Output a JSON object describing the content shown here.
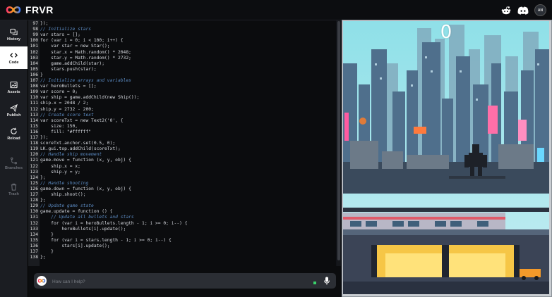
{
  "app": {
    "name": "FRVR",
    "user_initials": "AN"
  },
  "colors": {
    "accent": "#4a6cf7",
    "sky": "#8fdde6",
    "active_tab": "#ffffff"
  },
  "topbar": {
    "icons": [
      "reddit-icon",
      "discord-icon",
      "user-avatar"
    ]
  },
  "sidebar": {
    "items": [
      {
        "label": "History",
        "icon": "history-icon",
        "state": "normal"
      },
      {
        "label": "Code",
        "icon": "code-icon",
        "state": "active"
      },
      {
        "label": "Assets",
        "icon": "image-icon",
        "state": "normal"
      },
      {
        "label": "Publish",
        "icon": "send-icon",
        "state": "normal"
      },
      {
        "label": "Reload",
        "icon": "reload-icon",
        "state": "normal"
      },
      {
        "label": "Branches",
        "icon": "branch-icon",
        "state": "disabled"
      },
      {
        "label": "Trash",
        "icon": "trash-icon",
        "state": "disabled"
      }
    ]
  },
  "code": {
    "lines": [
      {
        "n": "97",
        "text": "});",
        "kind": "code"
      },
      {
        "n": "98",
        "text": "// Initialize stars",
        "kind": "comment"
      },
      {
        "n": "99",
        "text": "var stars = [];",
        "kind": "code"
      },
      {
        "n": "100",
        "text": "for (var i = 0; i < 100; i++) {",
        "kind": "code"
      },
      {
        "n": "101",
        "text": "    var star = new Star();",
        "kind": "code"
      },
      {
        "n": "102",
        "text": "    star.x = Math.random() * 2048;",
        "kind": "code"
      },
      {
        "n": "103",
        "text": "    star.y = Math.random() * 2732;",
        "kind": "code"
      },
      {
        "n": "104",
        "text": "    game.addChild(star);",
        "kind": "code"
      },
      {
        "n": "105",
        "text": "    stars.push(star);",
        "kind": "code"
      },
      {
        "n": "106",
        "text": "}",
        "kind": "code"
      },
      {
        "n": "107",
        "text": "// Initialize arrays and variables",
        "kind": "comment"
      },
      {
        "n": "108",
        "text": "var heroBullets = [];",
        "kind": "code"
      },
      {
        "n": "109",
        "text": "var score = 0;",
        "kind": "code"
      },
      {
        "n": "110",
        "text": "var ship = game.addChild(new Ship());",
        "kind": "code"
      },
      {
        "n": "111",
        "text": "ship.x = 2048 / 2;",
        "kind": "code"
      },
      {
        "n": "112",
        "text": "ship.y = 2732 - 200;",
        "kind": "code"
      },
      {
        "n": "113",
        "text": "// Create score text",
        "kind": "comment"
      },
      {
        "n": "114",
        "text": "var scoreTxt = new Text2('0', {",
        "kind": "code"
      },
      {
        "n": "115",
        "text": "    size: 150,",
        "kind": "code"
      },
      {
        "n": "116",
        "text": "    fill: \"#ffffff\"",
        "kind": "code"
      },
      {
        "n": "117",
        "text": "});",
        "kind": "code"
      },
      {
        "n": "118",
        "text": "scoreTxt.anchor.set(0.5, 0);",
        "kind": "code"
      },
      {
        "n": "119",
        "text": "LK.gui.top.addChild(scoreTxt);",
        "kind": "code"
      },
      {
        "n": "120",
        "text": "// Handle ship movement",
        "kind": "comment"
      },
      {
        "n": "121",
        "text": "game.move = function (x, y, obj) {",
        "kind": "code"
      },
      {
        "n": "122",
        "text": "    ship.x = x;",
        "kind": "code"
      },
      {
        "n": "123",
        "text": "    ship.y = y;",
        "kind": "code"
      },
      {
        "n": "124",
        "text": "};",
        "kind": "code"
      },
      {
        "n": "125",
        "text": "// Handle shooting",
        "kind": "comment"
      },
      {
        "n": "126",
        "text": "game.down = function (x, y, obj) {",
        "kind": "code"
      },
      {
        "n": "127",
        "text": "    ship.shoot();",
        "kind": "code"
      },
      {
        "n": "128",
        "text": "};",
        "kind": "code"
      },
      {
        "n": "129",
        "text": "// Update game state",
        "kind": "comment"
      },
      {
        "n": "130",
        "text": "game.update = function () {",
        "kind": "code"
      },
      {
        "n": "131",
        "text": "    // Update all bullets and stars",
        "kind": "comment"
      },
      {
        "n": "132",
        "text": "    for (var i = heroBullets.length - 1; i >= 0; i--) {",
        "kind": "code"
      },
      {
        "n": "133",
        "text": "        heroBullets[i].update();",
        "kind": "code"
      },
      {
        "n": "134",
        "text": "    }",
        "kind": "code"
      },
      {
        "n": "135",
        "text": "    for (var i = stars.length - 1; i >= 0; i--) {",
        "kind": "code"
      },
      {
        "n": "136",
        "text": "        stars[i].update();",
        "kind": "code"
      },
      {
        "n": "137",
        "text": "    }",
        "kind": "code"
      },
      {
        "n": "138",
        "text": "};",
        "kind": "code"
      }
    ]
  },
  "prompt": {
    "placeholder": "How can I help?",
    "icon": "mic-icon"
  },
  "preview": {
    "score": "0",
    "scene": "pixel-art cyberpunk city with train station and robot"
  }
}
